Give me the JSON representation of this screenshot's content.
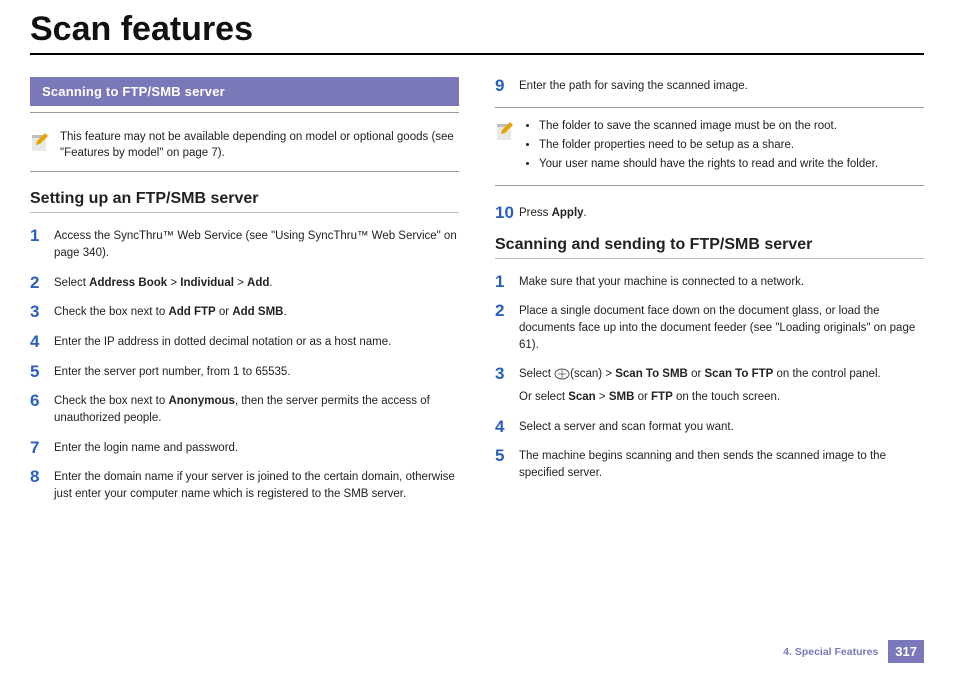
{
  "page_title": "Scan features",
  "section_banner": "Scanning to FTP/SMB server",
  "note1": "This feature may not be available depending on model or optional goods (see \"Features by model\" on page 7).",
  "subheading_setup": "Setting up an FTP/SMB server",
  "setup_steps": [
    {
      "n": "1",
      "t": "Access the SyncThru™ Web Service (see \"Using SyncThru™ Web Service\" on page 340)."
    },
    {
      "n": "2",
      "pre": "Select ",
      "b1": "Address Book",
      "sep1": " > ",
      "b2": "Individual",
      "sep2": " > ",
      "b3": "Add",
      "post": "."
    },
    {
      "n": "3",
      "pre": "Check the box next to ",
      "b1": "Add FTP",
      "sep1": " or ",
      "b2": "Add SMB",
      "post": "."
    },
    {
      "n": "4",
      "t": "Enter the IP address in dotted decimal notation or as a host name."
    },
    {
      "n": "5",
      "t": "Enter the server port number, from 1 to 65535."
    },
    {
      "n": "6",
      "pre": "Check the box next to ",
      "b1": "Anonymous",
      "post": ", then the server permits the access of unauthorized people."
    },
    {
      "n": "7",
      "t": "Enter the login name and password."
    },
    {
      "n": "8",
      "t": "Enter the domain name if your server is joined to the certain domain, otherwise just enter your computer name which is registered to the SMB server."
    },
    {
      "n": "9",
      "t": "Enter the path for saving the scanned image."
    },
    {
      "n": "10",
      "pre": "Press ",
      "b1": "Apply",
      "post": "."
    }
  ],
  "note2_items": [
    "The folder to save the scanned image must be on the root.",
    "The folder properties need to be setup as a share.",
    "Your user name should have the rights to read and write the folder."
  ],
  "subheading_send": "Scanning and sending to FTP/SMB server",
  "send_steps": [
    {
      "n": "1",
      "t": "Make sure that your machine is connected to a network."
    },
    {
      "n": "2",
      "t": "Place a single document face down on the document glass, or load the documents face up into the document feeder (see \"Loading originals\" on page 61)."
    },
    {
      "n": "3",
      "pre": "Select ",
      "icon": true,
      "mid1": "(scan) > ",
      "b1": "Scan To SMB",
      "sep1": " or ",
      "b2": "Scan To FTP",
      "post": " on the control panel.",
      "sub_pre": "Or select ",
      "sb1": "Scan",
      "ssep1": " > ",
      "sb2": "SMB",
      "ssep2": " or ",
      "sb3": "FTP",
      "spost": " on the touch screen."
    },
    {
      "n": "4",
      "t": "Select a server and scan format you want."
    },
    {
      "n": "5",
      "t": "The machine begins scanning and then sends the scanned image to the specified server."
    }
  ],
  "footer_chapter": "4.  Special Features",
  "footer_page": "317"
}
